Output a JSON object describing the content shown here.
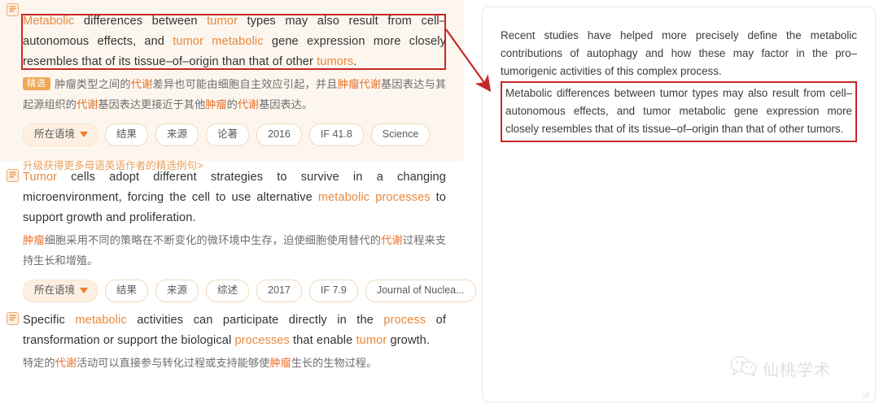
{
  "left_panel": {
    "entries": [
      {
        "featured": true,
        "icon": "document-icon",
        "sentence_parts": [
          {
            "t": "Metabolic",
            "hl": true
          },
          {
            "t": " differences between ",
            "hl": false
          },
          {
            "t": "tumor",
            "hl": true
          },
          {
            "t": " types may also result from cell–autonomous effects, and ",
            "hl": false
          },
          {
            "t": "tumor metabolic",
            "hl": true
          },
          {
            "t": " gene expression more closely resembles that of its tissue–of–origin than that of other ",
            "hl": false
          },
          {
            "t": "tumors",
            "hl": true
          },
          {
            "t": ".",
            "hl": false
          }
        ],
        "badge": "精选",
        "translation_parts": [
          {
            "t": "肿瘤",
            "hl": false
          },
          {
            "t": "类型之间的",
            "hl": false
          },
          {
            "t": "代谢",
            "hl": true
          },
          {
            "t": "差异也可能由细胞自主效应引起，并且",
            "hl": false
          },
          {
            "t": "肿瘤代谢",
            "hl": true
          },
          {
            "t": "基因表达与其起源组织的",
            "hl": false
          },
          {
            "t": "代谢",
            "hl": true
          },
          {
            "t": "基因表达更接近于其他",
            "hl": false
          },
          {
            "t": "肿瘤",
            "hl": true
          },
          {
            "t": "的",
            "hl": false
          },
          {
            "t": "代谢",
            "hl": true
          },
          {
            "t": "基因表达。",
            "hl": false
          }
        ],
        "tags": {
          "context_label": "所在语境",
          "items": [
            "结果",
            "来源",
            "论著",
            "2016",
            "IF 41.8",
            "Science"
          ]
        },
        "upgrade_text": "升级获得更多母语英语作者的精选例句>"
      },
      {
        "featured": false,
        "icon": "document-icon",
        "sentence_parts": [
          {
            "t": "Tumor",
            "hl": true
          },
          {
            "t": " cells adopt different strategies to survive in a changing microenvironment, forcing the cell to use alternative ",
            "hl": false
          },
          {
            "t": "metabolic processes",
            "hl": true
          },
          {
            "t": " to support growth and proliferation.",
            "hl": false
          }
        ],
        "badge": "",
        "translation_parts": [
          {
            "t": "肿瘤",
            "hl": true
          },
          {
            "t": "细胞采用不同的策略在不断变化的微环境中生存，迫使细胞使用替代的",
            "hl": false
          },
          {
            "t": "代谢",
            "hl": true
          },
          {
            "t": "过程来支持生长和增殖。",
            "hl": false
          }
        ],
        "tags": {
          "context_label": "所在语境",
          "items": [
            "结果",
            "来源",
            "综述",
            "2017",
            "IF 7.9",
            "Journal of Nuclea..."
          ]
        },
        "upgrade_text": ""
      },
      {
        "featured": false,
        "icon": "document-icon",
        "sentence_parts": [
          {
            "t": "Specific ",
            "hl": false
          },
          {
            "t": "metabolic",
            "hl": true
          },
          {
            "t": " activities can participate directly in the ",
            "hl": false
          },
          {
            "t": "process",
            "hl": true
          },
          {
            "t": " of transformation or support the biological ",
            "hl": false
          },
          {
            "t": "processes",
            "hl": true
          },
          {
            "t": " that enable ",
            "hl": false
          },
          {
            "t": "tumor",
            "hl": true
          },
          {
            "t": " growth.",
            "hl": false
          }
        ],
        "badge": "",
        "translation_parts": [
          {
            "t": "特定的",
            "hl": false
          },
          {
            "t": "代谢",
            "hl": true
          },
          {
            "t": "活动可以直接参与转化过程或支持能够使",
            "hl": false
          },
          {
            "t": "肿瘤",
            "hl": true
          },
          {
            "t": "生长的生物过程。",
            "hl": false
          }
        ],
        "tags": null,
        "upgrade_text": ""
      }
    ]
  },
  "right_panel": {
    "paragraph": "Recent studies have helped more precisely define the metabolic contributions of autophagy and how these may factor in the pro–tumorigenic activities of this complex process.",
    "highlighted_paragraph": "Metabolic differences between tumor types may also result from cell–autonomous effects, and tumor metabolic gene expression more closely resembles that of its tissue–of–origin than that of other tumors."
  },
  "watermark": {
    "icon": "wechat-icon",
    "text": "仙桃学术"
  },
  "annotations": {
    "arrow_icon": "red-arrow-icon",
    "highlight_box_color": "#c62828"
  },
  "colors": {
    "accent_orange": "#e8883a",
    "featured_bg": "#fdf6ee",
    "annotation_red": "#c62828"
  }
}
